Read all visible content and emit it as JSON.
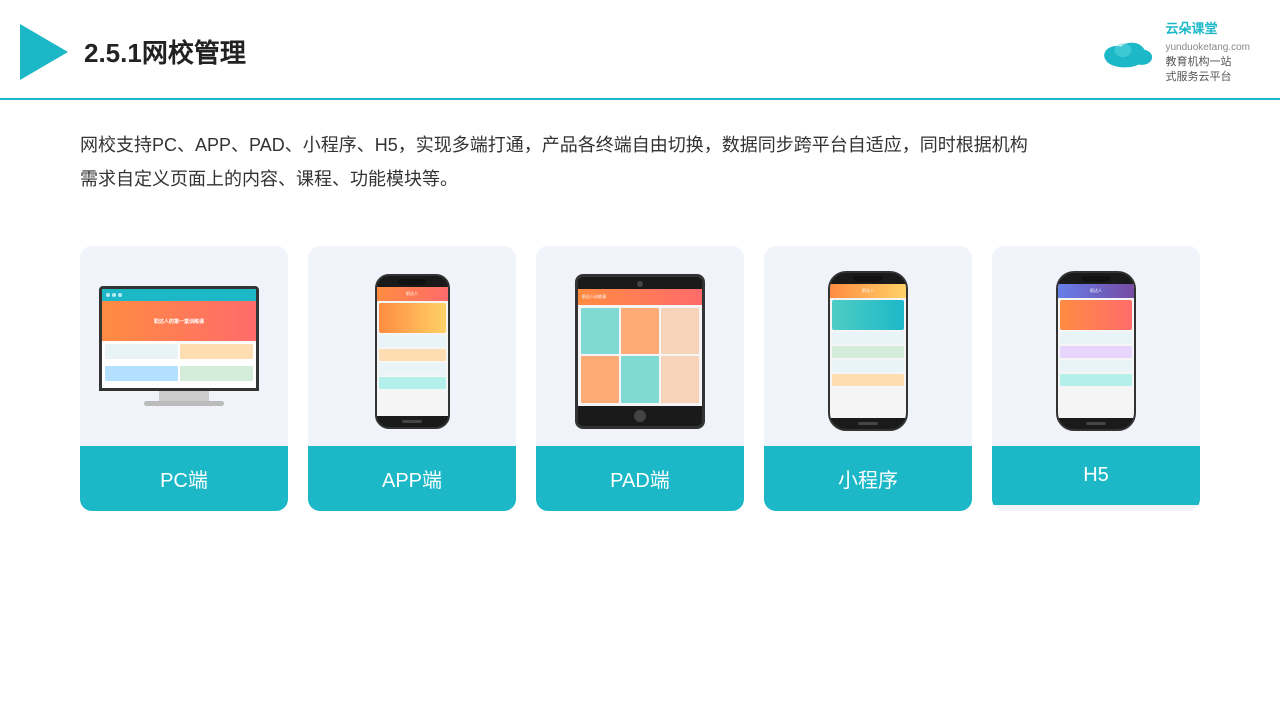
{
  "header": {
    "title": "2.5.1网校管理",
    "brand_name": "云朵课堂",
    "brand_url": "yunduoketang.com",
    "brand_tagline": "教育机构一站\n式服务云平台"
  },
  "description": {
    "text": "网校支持PC、APP、PAD、小程序、H5，实现多端打通，产品各终端自由切换，数据同步跨平台自适应，同时根据机构需求自定义页面上的内容、课程、功能模块等。"
  },
  "cards": [
    {
      "id": "pc",
      "label": "PC端"
    },
    {
      "id": "app",
      "label": "APP端"
    },
    {
      "id": "pad",
      "label": "PAD端"
    },
    {
      "id": "miniprogram",
      "label": "小程序"
    },
    {
      "id": "h5",
      "label": "H5"
    }
  ]
}
